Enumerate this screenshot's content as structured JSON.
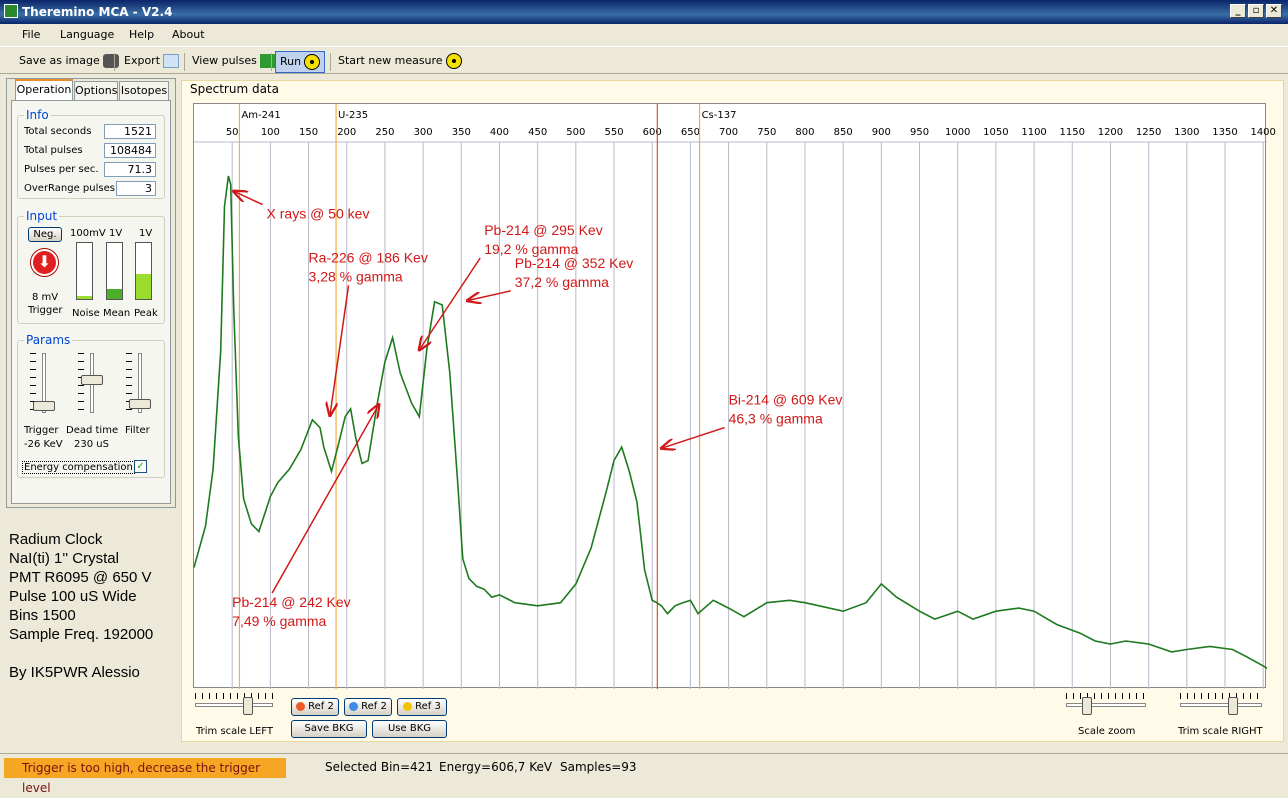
{
  "window": {
    "title": "Theremino MCA - V2.4"
  },
  "menu": [
    "File",
    "Language",
    "Help",
    "About"
  ],
  "toolbar": {
    "save_image": "Save as image",
    "export": "Export",
    "view_pulses": "View pulses",
    "run": "Run",
    "start_new": "Start new measure"
  },
  "tabs": [
    "Operation",
    "Options",
    "Isotopes"
  ],
  "info": {
    "title": "Info",
    "rows": [
      {
        "label": "Total seconds",
        "value": "1521"
      },
      {
        "label": "Total pulses",
        "value": "108484"
      },
      {
        "label": "Pulses per sec.",
        "value": "71.3"
      },
      {
        "label": "OverRange pulses",
        "value": "3"
      }
    ]
  },
  "input": {
    "title": "Input",
    "neg_label": "Neg.",
    "trigger_value": "8 mV",
    "trigger_label": "Trigger",
    "meters": [
      {
        "scale": "100mV",
        "label": "Noise",
        "level": 0.05
      },
      {
        "scale": "1V",
        "label": "Mean",
        "level": 0.18
      },
      {
        "scale": "1V",
        "label": "Peak",
        "level": 0.45
      }
    ]
  },
  "params": {
    "title": "Params",
    "sliders": [
      {
        "label": "Trigger",
        "value": "-26 KeV",
        "level": 0.12
      },
      {
        "label": "Dead time",
        "value": "230 uS",
        "level": 0.55
      },
      {
        "label": "Filter",
        "value": "",
        "level": 0.15
      }
    ],
    "energy_comp": "Energy compensation",
    "energy_checked": "✓"
  },
  "notes": [
    "Radium Clock",
    "NaI(ti) 1''  Crystal",
    "PMT R6095 @ 650 V",
    "Pulse 100 uS Wide",
    "Bins 1500",
    "Sample Freq. 192000",
    "By IK5PWR Alessio"
  ],
  "spectrum": {
    "title": "Spectrum data"
  },
  "chart_data": {
    "type": "line",
    "x_ticks": [
      50,
      100,
      150,
      200,
      250,
      300,
      350,
      400,
      450,
      500,
      550,
      600,
      650,
      700,
      750,
      800,
      850,
      900,
      950,
      1000,
      1050,
      1100,
      1150,
      1200,
      1250,
      1300,
      1350,
      1400
    ],
    "xlim": [
      0,
      1405
    ],
    "ylim": [
      0,
      1
    ],
    "markers": [
      {
        "name": "Am-241",
        "kev": 59.5,
        "color": "#f0b040"
      },
      {
        "name": "U-235",
        "kev": 186,
        "color": "#f0b040"
      },
      {
        "name": "Cs-137",
        "kev": 662,
        "color": "#f0b040"
      },
      {
        "name": "",
        "kev": 606.7,
        "color": "#e05020"
      }
    ],
    "series": [
      {
        "color": "#1e7a1e",
        "x": [
          0,
          15,
          25,
          35,
          40,
          45,
          48,
          52,
          58,
          65,
          75,
          85,
          100,
          110,
          125,
          140,
          155,
          165,
          170,
          180,
          190,
          198,
          205,
          212,
          220,
          228,
          240,
          250,
          260,
          270,
          285,
          295,
          305,
          315,
          325,
          335,
          345,
          352,
          360,
          370,
          380,
          390,
          400,
          420,
          450,
          480,
          500,
          520,
          540,
          550,
          560,
          570,
          580,
          590,
          600,
          606,
          612,
          620,
          630,
          640,
          650,
          660,
          680,
          700,
          720,
          750,
          780,
          800,
          850,
          880,
          900,
          920,
          950,
          970,
          1000,
          1020,
          1050,
          1080,
          1100,
          1130,
          1160,
          1180,
          1200,
          1220,
          1250,
          1280,
          1300,
          1330,
          1360,
          1380,
          1400,
          1405
        ],
        "y": [
          0.22,
          0.3,
          0.4,
          0.62,
          0.88,
          0.94,
          0.92,
          0.7,
          0.46,
          0.35,
          0.3,
          0.29,
          0.35,
          0.38,
          0.4,
          0.44,
          0.49,
          0.48,
          0.44,
          0.4,
          0.45,
          0.5,
          0.51,
          0.46,
          0.41,
          0.42,
          0.52,
          0.6,
          0.64,
          0.58,
          0.52,
          0.5,
          0.62,
          0.71,
          0.7,
          0.58,
          0.38,
          0.24,
          0.2,
          0.19,
          0.18,
          0.17,
          0.17,
          0.16,
          0.15,
          0.16,
          0.19,
          0.26,
          0.36,
          0.42,
          0.44,
          0.4,
          0.34,
          0.22,
          0.16,
          0.16,
          0.15,
          0.14,
          0.15,
          0.16,
          0.16,
          0.14,
          0.16,
          0.15,
          0.13,
          0.16,
          0.16,
          0.16,
          0.14,
          0.16,
          0.19,
          0.17,
          0.14,
          0.13,
          0.14,
          0.13,
          0.14,
          0.15,
          0.14,
          0.12,
          0.1,
          0.09,
          0.08,
          0.09,
          0.08,
          0.07,
          0.07,
          0.08,
          0.07,
          0.06,
          0.04,
          0.04
        ]
      }
    ],
    "annotations": [
      {
        "text": [
          "X rays @ 50 kev"
        ],
        "tx": 95,
        "ty": 0.86,
        "ax": 52,
        "ay": 0.91
      },
      {
        "text": [
          "Ra-226 @ 186 Kev",
          "3,28 % gamma"
        ],
        "tx": 150,
        "ty": 0.78,
        "ax": 178,
        "ay": 0.5
      },
      {
        "text": [
          "Pb-214 @ 295 Kev",
          "19,2 % gamma"
        ],
        "tx": 380,
        "ty": 0.83,
        "ax": 295,
        "ay": 0.62
      },
      {
        "text": [
          "Pb-214 @ 352 Kev",
          "37,2 % gamma"
        ],
        "tx": 420,
        "ty": 0.77,
        "ax": 358,
        "ay": 0.71
      },
      {
        "text": [
          "Bi-214 @ 609 Kev",
          "46,3 % gamma"
        ],
        "tx": 700,
        "ty": 0.52,
        "ax": 612,
        "ay": 0.44
      },
      {
        "text": [
          "Pb-214 @ 242 Kev",
          "7,49 % gamma"
        ],
        "tx": 50,
        "ty": 0.15,
        "ax": 242,
        "ay": 0.52
      }
    ]
  },
  "bottom": {
    "trim_left": "Trim scale LEFT",
    "ref_buttons": [
      "Ref 2",
      "Ref 2",
      "Ref 3"
    ],
    "save_bkg": "Save BKG",
    "use_bkg": "Use BKG",
    "scale_zoom": "Scale zoom",
    "trim_right": "Trim scale RIGHT"
  },
  "status": {
    "warning": "Trigger is too high, decrease the trigger level",
    "selected_bin": "Selected Bin=421",
    "energy": "Energy=606,7 KeV",
    "samples": "Samples=93"
  }
}
